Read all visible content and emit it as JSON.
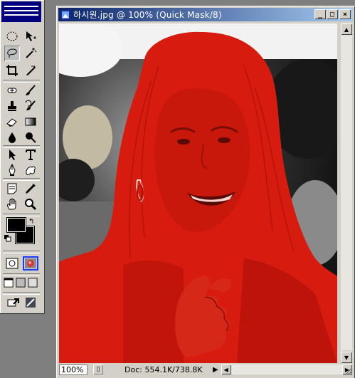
{
  "document": {
    "title": "하시원.jpg @ 100% (Quick Mask/8)",
    "zoom": "100%",
    "doc_info": "Doc: 554.1K/738.8K",
    "mask_color": "#d81b0f",
    "active_mode": "Quick Mask"
  },
  "window_buttons": {
    "minimize": "_",
    "maximize": "□",
    "close": "×"
  },
  "toolbox": {
    "title_color": "#00007f",
    "tools": [
      "marquee-icon",
      "move-icon",
      "lasso-icon",
      "magic-wand-icon",
      "crop-icon",
      "slice-icon",
      "healing-brush-icon",
      "brush-icon",
      "clone-stamp-icon",
      "history-brush-icon",
      "eraser-icon",
      "gradient-icon",
      "blur-icon",
      "dodge-icon",
      "path-selection-icon",
      "type-icon",
      "pen-icon",
      "custom-shape-icon",
      "notes-icon",
      "eyedropper-icon",
      "hand-icon",
      "zoom-icon"
    ],
    "foreground_color": "#000000",
    "background_color": "#000000",
    "quick_mask_highlight": "#1a3cff"
  }
}
